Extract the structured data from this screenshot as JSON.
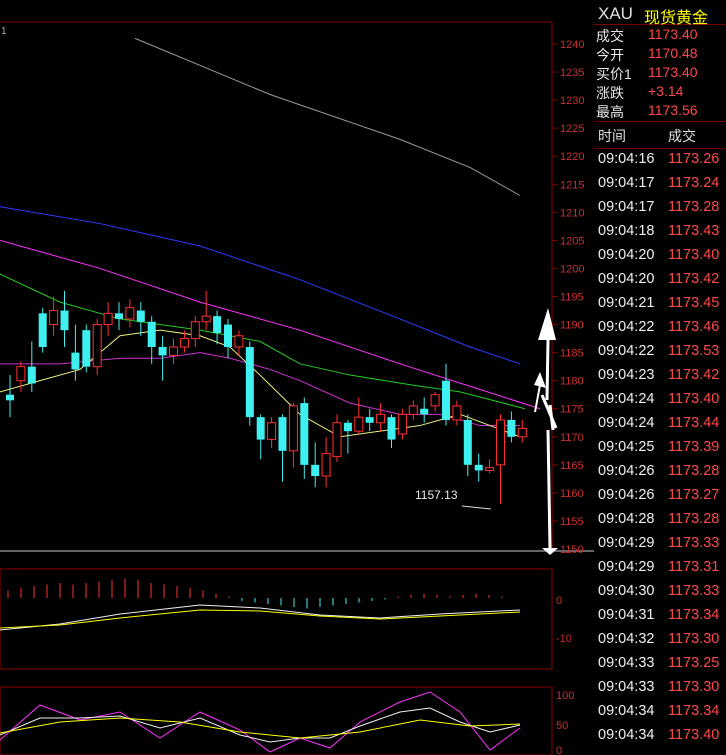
{
  "panel": {
    "symbol": "XAU",
    "name": "现货黄金",
    "quotes": [
      {
        "label": "成交",
        "value": "1173.40"
      },
      {
        "label": "今开",
        "value": "1170.48"
      },
      {
        "label": "买价1",
        "value": "1173.40"
      },
      {
        "label": "涨跌",
        "value": "+3.14"
      },
      {
        "label": "最高",
        "value": "1173.56"
      }
    ],
    "col_time": "时间",
    "col_price": "成交",
    "ticks": [
      {
        "t": "09:04:16",
        "p": "1173.26"
      },
      {
        "t": "09:04:17",
        "p": "1173.24"
      },
      {
        "t": "09:04:17",
        "p": "1173.28"
      },
      {
        "t": "09:04:18",
        "p": "1173.43"
      },
      {
        "t": "09:04:20",
        "p": "1173.40"
      },
      {
        "t": "09:04:20",
        "p": "1173.42"
      },
      {
        "t": "09:04:21",
        "p": "1173.45"
      },
      {
        "t": "09:04:22",
        "p": "1173.46"
      },
      {
        "t": "09:04:22",
        "p": "1173.53"
      },
      {
        "t": "09:04:23",
        "p": "1173.42"
      },
      {
        "t": "09:04:24",
        "p": "1173.40"
      },
      {
        "t": "09:04:24",
        "p": "1173.44"
      },
      {
        "t": "09:04:25",
        "p": "1173.39"
      },
      {
        "t": "09:04:26",
        "p": "1173.28"
      },
      {
        "t": "09:04:26",
        "p": "1173.27"
      },
      {
        "t": "09:04:28",
        "p": "1173.28"
      },
      {
        "t": "09:04:29",
        "p": "1173.33"
      },
      {
        "t": "09:04:29",
        "p": "1173.31"
      },
      {
        "t": "09:04:30",
        "p": "1173.33"
      },
      {
        "t": "09:04:31",
        "p": "1173.34"
      },
      {
        "t": "09:04:32",
        "p": "1173.30"
      },
      {
        "t": "09:04:33",
        "p": "1173.25"
      },
      {
        "t": "09:04:33",
        "p": "1173.30"
      },
      {
        "t": "09:04:34",
        "p": "1173.34"
      },
      {
        "t": "09:04:34",
        "p": "1173.40"
      }
    ]
  },
  "chart_data": {
    "type": "candlestick",
    "top_left_label": "1",
    "price_axis": {
      "ticks": [
        "1240",
        "1235",
        "1230",
        "1225",
        "1220",
        "1215",
        "1210",
        "1205",
        "1200",
        "1195",
        "1190",
        "1185",
        "1180",
        "1175",
        "1170",
        "1165",
        "1160",
        "1155",
        "1150"
      ],
      "ylim": [
        1150,
        1242
      ]
    },
    "low_annotation": {
      "label": "1157.13",
      "value": 1157.13
    },
    "candles": [
      [
        1177.5,
        1176.5,
        1181,
        1173.5
      ],
      [
        1180,
        1182.5,
        1183.5,
        1178
      ],
      [
        1182.5,
        1179.5,
        1187,
        1178
      ],
      [
        1192,
        1186,
        1193,
        1185
      ],
      [
        1190,
        1192.5,
        1195,
        1188
      ],
      [
        1192.5,
        1189,
        1196,
        1186
      ],
      [
        1185,
        1182,
        1190,
        1180
      ],
      [
        1189,
        1182.5,
        1190,
        1181.5
      ],
      [
        1182.5,
        1190,
        1191,
        1181
      ],
      [
        1190,
        1192,
        1194,
        1188
      ],
      [
        1192,
        1191,
        1194,
        1189
      ],
      [
        1191,
        1193,
        1194.5,
        1189.5
      ],
      [
        1192.5,
        1190.5,
        1194,
        1188
      ],
      [
        1190.5,
        1186,
        1191.5,
        1183
      ],
      [
        1186,
        1184.5,
        1188,
        1180
      ],
      [
        1184.5,
        1186,
        1187.5,
        1183
      ],
      [
        1186,
        1187.5,
        1189,
        1185
      ],
      [
        1187.5,
        1190.5,
        1191.5,
        1186
      ],
      [
        1190.5,
        1191.5,
        1196,
        1189
      ],
      [
        1191.5,
        1188.5,
        1192.5,
        1186.5
      ],
      [
        1190,
        1186,
        1191,
        1184
      ],
      [
        1186,
        1188,
        1189,
        1184.5
      ],
      [
        1186,
        1173.5,
        1187,
        1172
      ],
      [
        1173.5,
        1169.5,
        1174,
        1166
      ],
      [
        1169.5,
        1172.5,
        1173.5,
        1168
      ],
      [
        1173.5,
        1167.5,
        1174,
        1162
      ],
      [
        1167.5,
        1175.5,
        1176,
        1164.5
      ],
      [
        1176,
        1165,
        1177,
        1162.5
      ],
      [
        1165,
        1163,
        1169,
        1161
      ],
      [
        1163,
        1167,
        1170,
        1161
      ],
      [
        1166.5,
        1172.5,
        1174,
        1165.5
      ],
      [
        1172.5,
        1171,
        1173,
        1167
      ],
      [
        1171,
        1173.5,
        1177,
        1170.5
      ],
      [
        1173.5,
        1172.5,
        1175,
        1171
      ],
      [
        1172.5,
        1174,
        1176,
        1171
      ],
      [
        1173.5,
        1169.5,
        1174,
        1168
      ],
      [
        1170.5,
        1174,
        1175,
        1169.5
      ],
      [
        1174,
        1175.5,
        1176.5,
        1173
      ],
      [
        1175,
        1174,
        1177,
        1172.5
      ],
      [
        1175.5,
        1177.5,
        1178,
        1174.5
      ],
      [
        1180,
        1173,
        1183,
        1172
      ],
      [
        1173,
        1175.5,
        1176.5,
        1172
      ],
      [
        1173,
        1165,
        1174,
        1163
      ],
      [
        1165,
        1164,
        1167,
        1162
      ],
      [
        1164,
        1164.5,
        1166,
        1163.5
      ],
      [
        1165,
        1173,
        1174,
        1158
      ],
      [
        1173,
        1170,
        1174.5,
        1169
      ],
      [
        1170,
        1171.5,
        1173,
        1169
      ]
    ],
    "ma_gray": [
      [
        135,
        1241
      ],
      [
        270,
        1231
      ],
      [
        400,
        1223
      ],
      [
        470,
        1218
      ],
      [
        520,
        1213
      ]
    ],
    "ma_blue": [
      [
        0,
        1211
      ],
      [
        100,
        1208
      ],
      [
        200,
        1204
      ],
      [
        300,
        1198
      ],
      [
        400,
        1191
      ],
      [
        470,
        1186
      ],
      [
        520,
        1183
      ]
    ],
    "ma_magenta": [
      [
        0,
        1205
      ],
      [
        100,
        1200
      ],
      [
        200,
        1194
      ],
      [
        300,
        1189
      ],
      [
        400,
        1183
      ],
      [
        470,
        1179
      ],
      [
        540,
        1175
      ]
    ],
    "ma_green": [
      [
        0,
        1199
      ],
      [
        60,
        1194
      ],
      [
        120,
        1191
      ],
      [
        200,
        1189
      ],
      [
        260,
        1187
      ],
      [
        300,
        1183
      ],
      [
        350,
        1181
      ],
      [
        420,
        1179
      ],
      [
        460,
        1178
      ],
      [
        525,
        1175
      ]
    ],
    "ma_yellow": [
      [
        0,
        1178
      ],
      [
        40,
        1180
      ],
      [
        80,
        1182
      ],
      [
        120,
        1188
      ],
      [
        160,
        1189
      ],
      [
        200,
        1188
      ],
      [
        230,
        1186
      ],
      [
        260,
        1181
      ],
      [
        300,
        1174
      ],
      [
        340,
        1170
      ],
      [
        380,
        1171
      ],
      [
        420,
        1172
      ],
      [
        460,
        1174
      ],
      [
        490,
        1172
      ],
      [
        520,
        1170
      ]
    ],
    "ma_purple": [
      [
        0,
        1183
      ],
      [
        60,
        1183
      ],
      [
        120,
        1184
      ],
      [
        160,
        1184
      ],
      [
        200,
        1185
      ],
      [
        230,
        1184
      ],
      [
        270,
        1182
      ],
      [
        300,
        1180
      ],
      [
        350,
        1176
      ],
      [
        400,
        1174
      ],
      [
        440,
        1174
      ],
      [
        480,
        1172
      ],
      [
        520,
        1172
      ]
    ],
    "macd_axis": [
      "0",
      "-10"
    ],
    "macd_bars": [
      5,
      7,
      8,
      9,
      10,
      9,
      10,
      11,
      12,
      13,
      12,
      10,
      9,
      8,
      7,
      5,
      3,
      1,
      -2,
      -3,
      -4,
      -5,
      -6,
      -7,
      -6,
      -5,
      -4,
      -3,
      -2,
      -1,
      1,
      2,
      3,
      2,
      1,
      2,
      3,
      2,
      1
    ],
    "kdj_axis": [
      "100",
      "50",
      "0"
    ]
  }
}
